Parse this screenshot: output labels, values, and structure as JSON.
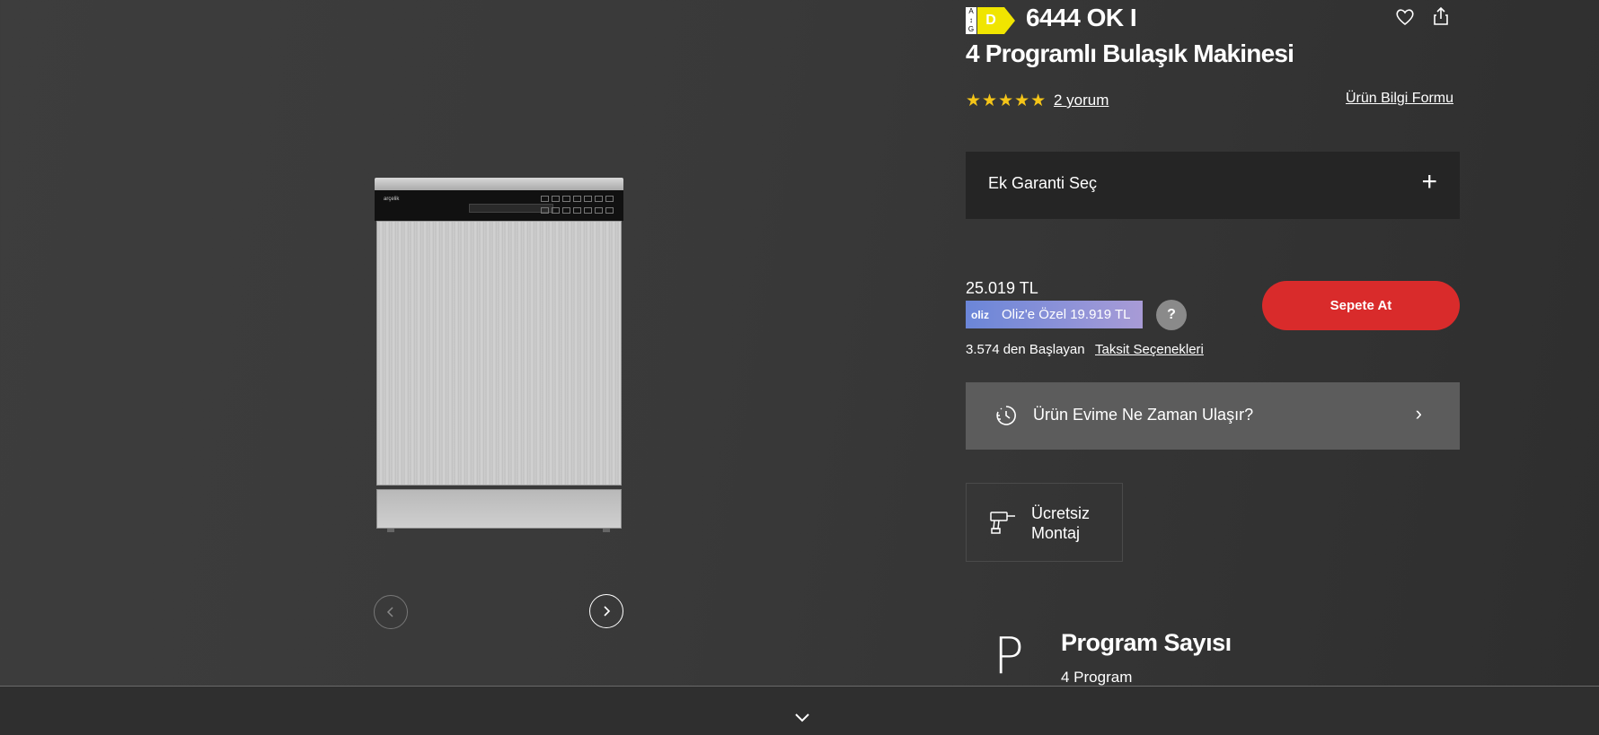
{
  "product": {
    "energy_scale_top": "A",
    "energy_scale_bottom": "G",
    "energy_class": "D",
    "model": "6444 OK I",
    "title": "4 Programlı Bulaşık Makinesi",
    "rating_stars": "★★★★★",
    "rating": 5,
    "reviews_link": "2 yorum",
    "info_form_link": "Ürün Bilgi Formu"
  },
  "image": {
    "brand_text": "arçelik",
    "prev_icon": "chevron-left-icon",
    "next_icon": "chevron-right-icon"
  },
  "warranty": {
    "label": "Ek Garanti Seç",
    "icon": "plus-icon"
  },
  "pricing": {
    "price": "25.019 TL",
    "oliz_logo": "oliz",
    "oliz_label": "Oliz'e Özel 19.919 TL",
    "help_mark": "?",
    "add_to_cart": "Sepete At",
    "installment_text": "3.574 den Başlayan",
    "installment_link": "Taksit Seçenekleri"
  },
  "delivery": {
    "label": "Ürün Evime Ne Zaman Ulaşır?",
    "icon": "clock-delivery-icon",
    "chevron": "›"
  },
  "service": {
    "line1": "Ücretsiz",
    "line2": "Montaj",
    "icon": "drill-icon"
  },
  "feature": {
    "letter": "P",
    "title": "Program Sayısı",
    "value": "4 Program"
  },
  "colors": {
    "accent_red": "#d92b2b",
    "star_yellow": "#f5c518",
    "energy_yellow": "#f0e500"
  }
}
